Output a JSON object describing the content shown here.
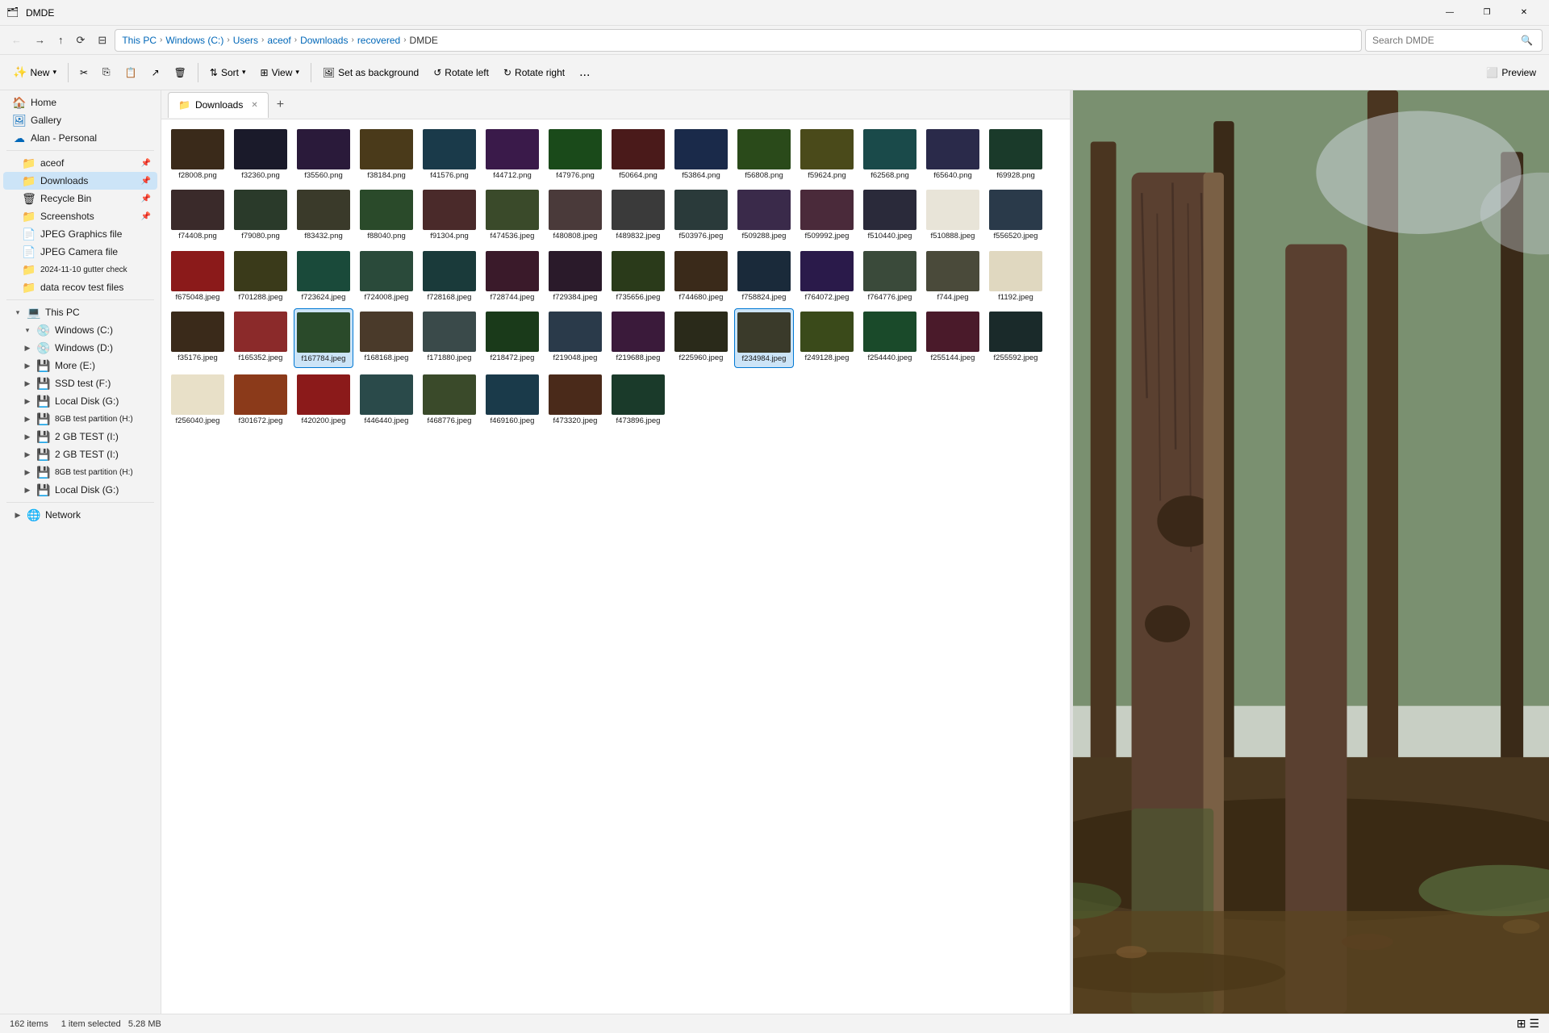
{
  "titlebar": {
    "title": "DMDE",
    "icon": "🗂",
    "min_label": "—",
    "restore_label": "❐",
    "close_label": "✕"
  },
  "navbar": {
    "back_label": "←",
    "forward_label": "→",
    "up_label": "↑",
    "refresh_label": "⟳",
    "view_label": "⊟",
    "breadcrumb": [
      "This PC",
      "Windows (C:)",
      "Users",
      "aceof",
      "Downloads",
      "recovered",
      "DMDE"
    ],
    "search_placeholder": "Search DMDE"
  },
  "toolbar": {
    "new_label": "New",
    "cut_label": "✂",
    "copy_label": "⎘",
    "paste_label": "⬜",
    "share_label": "↗",
    "delete_label": "🗑",
    "sort_label": "Sort",
    "view_label": "View",
    "set_bg_label": "Set as background",
    "rotate_left_label": "Rotate left",
    "rotate_right_label": "Rotate right",
    "more_label": "...",
    "preview_label": "Preview"
  },
  "tabs": [
    {
      "label": "Downloads",
      "active": true
    }
  ],
  "sidebar": {
    "quick_access": [
      {
        "label": "Home",
        "icon": "🏠",
        "type": "special",
        "indent": 0
      },
      {
        "label": "Gallery",
        "icon": "🖼",
        "type": "special",
        "indent": 0
      },
      {
        "label": "Alan - Personal",
        "icon": "☁",
        "type": "special",
        "indent": 0
      }
    ],
    "quick_access_pinned": [
      {
        "label": "aceof",
        "icon": "📁",
        "pin": true,
        "indent": 1
      },
      {
        "label": "Downloads",
        "icon": "📁",
        "pin": true,
        "indent": 1,
        "selected": true
      },
      {
        "label": "Recycle Bin",
        "icon": "🗑",
        "pin": true,
        "indent": 1
      },
      {
        "label": "Screenshots",
        "icon": "📁",
        "pin": true,
        "indent": 1
      },
      {
        "label": "JPEG Graphics file",
        "icon": "📄",
        "pin": false,
        "indent": 1
      },
      {
        "label": "JPEG Camera file",
        "icon": "📄",
        "pin": false,
        "indent": 1
      },
      {
        "label": "2024-11-10 gutter check",
        "icon": "📁",
        "pin": false,
        "indent": 1
      },
      {
        "label": "data recov test files",
        "icon": "📁",
        "pin": false,
        "indent": 1
      }
    ],
    "this_pc": {
      "label": "This PC",
      "expanded": true,
      "drives": [
        {
          "label": "Windows (C:)",
          "expanded": true
        },
        {
          "label": "Windows (D:)",
          "expanded": false
        },
        {
          "label": "More (E:)",
          "expanded": false
        },
        {
          "label": "SSD test (F:)",
          "expanded": false
        },
        {
          "label": "Local Disk (G:)",
          "expanded": false
        },
        {
          "label": "8GB test partition (H:)",
          "expanded": false
        },
        {
          "label": "2 GB TEST (I:)",
          "expanded": false
        },
        {
          "label": "2 GB TEST (I:)",
          "expanded": false
        },
        {
          "label": "8GB test partition (H:)",
          "expanded": false
        },
        {
          "label": "Local Disk (G:)",
          "expanded": false
        }
      ]
    },
    "network": {
      "label": "Network",
      "expanded": false
    }
  },
  "files": [
    {
      "name": "f28008.png",
      "color": "#3a2a1a"
    },
    {
      "name": "f32360.png",
      "color": "#1a1a2a"
    },
    {
      "name": "f35560.png",
      "color": "#2a1a3a"
    },
    {
      "name": "f38184.png",
      "color": "#4a3a1a"
    },
    {
      "name": "f41576.png",
      "color": "#1a3a4a"
    },
    {
      "name": "f44712.png",
      "color": "#3a1a4a"
    },
    {
      "name": "f47976.png",
      "color": "#1a4a1a"
    },
    {
      "name": "f50664.png",
      "color": "#4a1a1a"
    },
    {
      "name": "f53864.png",
      "color": "#1a2a4a"
    },
    {
      "name": "f56808.png",
      "color": "#2a4a1a"
    },
    {
      "name": "f59624.png",
      "color": "#4a4a1a"
    },
    {
      "name": "f62568.png",
      "color": "#1a4a4a"
    },
    {
      "name": "f65640.png",
      "color": "#2a2a4a"
    },
    {
      "name": "f69928.png",
      "color": "#1a3a2a"
    },
    {
      "name": "f74408.png",
      "color": "#3a2a2a"
    },
    {
      "name": "f79080.png",
      "color": "#2a3a2a"
    },
    {
      "name": "f83432.png",
      "color": "#3a3a2a"
    },
    {
      "name": "f88040.png",
      "color": "#2a4a2a"
    },
    {
      "name": "f91304.png",
      "color": "#4a2a2a"
    },
    {
      "name": "f474536.jpeg",
      "color": "#3a4a2a"
    },
    {
      "name": "f480808.jpeg",
      "color": "#4a3a3a"
    },
    {
      "name": "f489832.jpeg",
      "color": "#3a3a3a"
    },
    {
      "name": "f503976.jpeg",
      "color": "#2a3a3a"
    },
    {
      "name": "f509288.jpeg",
      "color": "#3a2a4a"
    },
    {
      "name": "f509992.jpeg",
      "color": "#4a2a3a"
    },
    {
      "name": "f510440.jpeg",
      "color": "#2a2a3a"
    },
    {
      "name": "f510888.jpeg",
      "color": "#e8e4d8"
    },
    {
      "name": "f556520.jpeg",
      "color": "#2a3a4a"
    },
    {
      "name": "f675048.jpeg",
      "color": "#8b1a1a"
    },
    {
      "name": "f701288.jpeg",
      "color": "#3a3a1a"
    },
    {
      "name": "f723624.jpeg",
      "color": "#1a4a3a"
    },
    {
      "name": "f724008.jpeg",
      "color": "#2a4a3a"
    },
    {
      "name": "f728168.jpeg",
      "color": "#1a3a3a"
    },
    {
      "name": "f728744.jpeg",
      "color": "#3a1a2a"
    },
    {
      "name": "f729384.jpeg",
      "color": "#2a1a2a"
    },
    {
      "name": "f735656.jpeg",
      "color": "#2a3a1a"
    },
    {
      "name": "f744680.jpeg",
      "color": "#3a2a1a"
    },
    {
      "name": "f758824.jpeg",
      "color": "#1a2a3a"
    },
    {
      "name": "f764072.jpeg",
      "color": "#2a1a4a"
    },
    {
      "name": "f764776.jpeg",
      "color": "#3a4a3a"
    },
    {
      "name": "f744.jpeg",
      "color": "#4a4a3a"
    },
    {
      "name": "f1192.jpeg",
      "color": "#e0d8c0"
    },
    {
      "name": "f35176.jpeg",
      "color": "#3a2a1a"
    },
    {
      "name": "f165352.jpeg",
      "color": "#8b2a2a"
    },
    {
      "name": "f167784.jpeg",
      "color": "#2a4a2a",
      "selected": true
    },
    {
      "name": "f168168.jpeg",
      "color": "#4a3a2a"
    },
    {
      "name": "f171880.jpeg",
      "color": "#3a4a4a"
    },
    {
      "name": "f218472.jpeg",
      "color": "#1a3a1a"
    },
    {
      "name": "f219048.jpeg",
      "color": "#2a3a4a"
    },
    {
      "name": "f219688.jpeg",
      "color": "#3a1a3a"
    },
    {
      "name": "f225960.jpeg",
      "color": "#2a2a1a"
    },
    {
      "name": "f234984.jpeg",
      "color": "#3a3a2a",
      "selected": true
    },
    {
      "name": "f249128.jpeg",
      "color": "#3a4a1a"
    },
    {
      "name": "f254440.jpeg",
      "color": "#1a4a2a"
    },
    {
      "name": "f255144.jpeg",
      "color": "#4a1a2a"
    },
    {
      "name": "f255592.jpeg",
      "color": "#1a2a2a"
    },
    {
      "name": "f256040.jpeg",
      "color": "#e8e0c8"
    },
    {
      "name": "f301672.jpeg",
      "color": "#8b3a1a"
    },
    {
      "name": "f420200.jpeg",
      "color": "#8b1a1a"
    },
    {
      "name": "f446440.jpeg",
      "color": "#2a4a4a"
    },
    {
      "name": "f468776.jpeg",
      "color": "#3a4a2a"
    },
    {
      "name": "f469160.jpeg",
      "color": "#1a3a4a"
    },
    {
      "name": "f473320.jpeg",
      "color": "#4a2a1a"
    },
    {
      "name": "f473896.jpeg",
      "color": "#1a3a2a"
    }
  ],
  "statusbar": {
    "count": "162 items",
    "selected": "1 item selected",
    "size": "5.28 MB"
  },
  "preview": {
    "visible": true
  }
}
